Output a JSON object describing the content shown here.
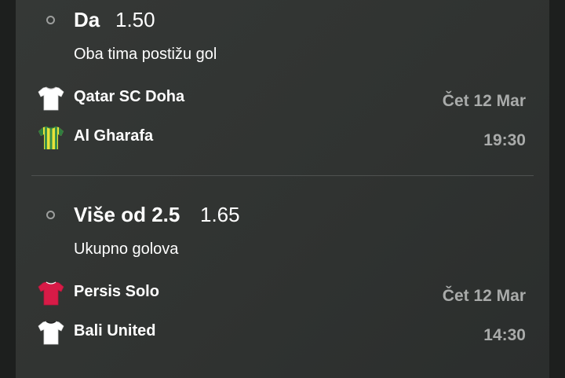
{
  "bets": [
    {
      "selection": "Da",
      "odds": "1.50",
      "market": "Oba tima postižu gol",
      "home_team": {
        "name": "Qatar SC Doha",
        "jersey": "white-jersey-icon"
      },
      "away_team": {
        "name": "Al Gharafa",
        "jersey": "yellow-green-striped-jersey-icon"
      },
      "date": "Čet 12 Mar",
      "time": "19:30"
    },
    {
      "selection": "Više od 2.5",
      "odds": "1.65",
      "market": "Ukupno golova",
      "home_team": {
        "name": "Persis Solo",
        "jersey": "red-jersey-icon"
      },
      "away_team": {
        "name": "Bali United",
        "jersey": "white-jersey-icon"
      },
      "date": "Čet 12 Mar",
      "time": "14:30"
    }
  ],
  "colors": {
    "background": "#1d1f1e",
    "panel": "#333634",
    "text_primary": "#ffffff",
    "text_secondary": "#a9abaa",
    "divider": "#4e5150",
    "jersey_red": "#d81b47",
    "jersey_yellow": "#e8e23a",
    "jersey_green": "#3a8f4a"
  }
}
